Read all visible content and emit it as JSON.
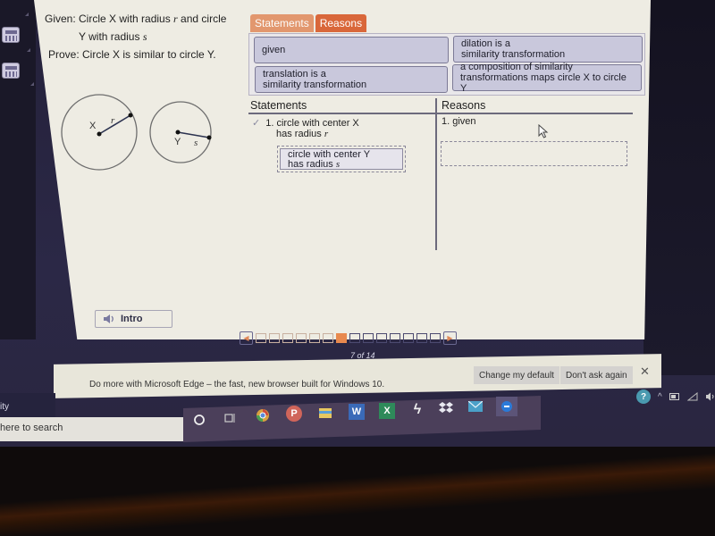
{
  "problem": {
    "given_line1_prefix": "Given: Circle X with radius ",
    "given_var_r": "r",
    "given_line1_suffix": " and circle",
    "given_line2_prefix": "Y with radius ",
    "given_var_s": "s",
    "prove": "Prove: Circle X is similar to circle Y."
  },
  "diagram": {
    "circle_x_label": "X",
    "circle_x_radius_label": "r",
    "circle_y_label": "Y",
    "circle_y_radius_label": "s"
  },
  "bank": {
    "tabs": [
      {
        "label": "Statements",
        "active": false
      },
      {
        "label": "Reasons",
        "active": true
      }
    ],
    "tiles": [
      {
        "line1": "given",
        "line2": ""
      },
      {
        "line1": "dilation is a",
        "line2": "similarity transformation"
      },
      {
        "line1": "translation is a",
        "line2": "similarity transformation"
      },
      {
        "line1": "a composition of similarity",
        "line2": "transformations maps circle X to circle Y"
      }
    ]
  },
  "proof": {
    "statements_header": "Statements",
    "reasons_header": "Reasons",
    "rows": [
      {
        "check": "✓",
        "statement_line1": "1. circle with center X",
        "statement_line2_prefix": "has radius ",
        "statement_var": "r",
        "reason": "1. given"
      }
    ],
    "pending_statement_line1": "circle with center Y",
    "pending_statement_line2_prefix": "has radius ",
    "pending_statement_var": "s"
  },
  "intro_button": {
    "label": "Intro",
    "icon": "speaker-icon"
  },
  "pager": {
    "current": 7,
    "total": 14,
    "label": "7 of 14",
    "prev_icon": "◀",
    "next_icon": "▶"
  },
  "edge_notification": {
    "message": "Do more with Microsoft Edge – the fast, new browser built for Windows 10.",
    "change_default_label": "Change my default",
    "dont_ask_label": "Don't ask again",
    "close_icon": "✕"
  },
  "taskbar": {
    "city_text": "ity",
    "search_placeholder": "here to search",
    "apps": [
      "cortana",
      "task-view",
      "chrome",
      "powerpoint",
      "file-explorer",
      "word",
      "excel",
      "app-s",
      "dropbox",
      "mail",
      "edge"
    ],
    "help_icon": "?",
    "tray_chevron": "^"
  }
}
